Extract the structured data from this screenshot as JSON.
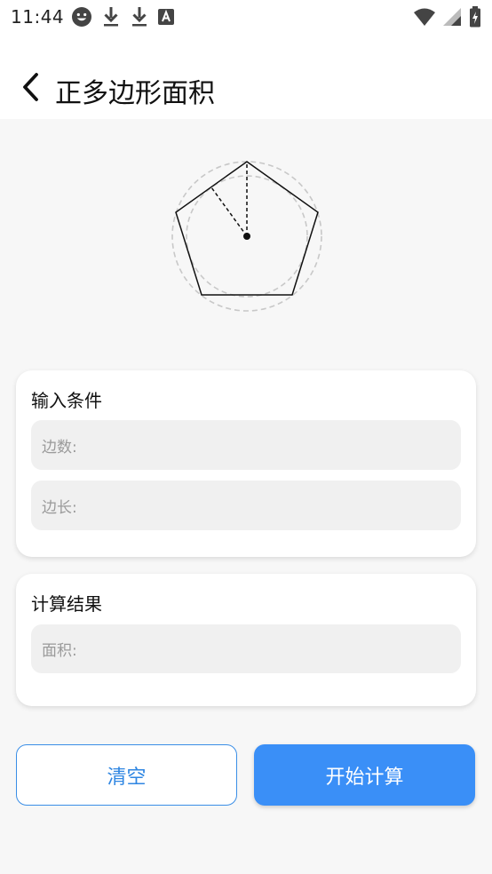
{
  "status_bar": {
    "time": "11:44",
    "left_icons": [
      "smiley-icon",
      "download-icon",
      "download-icon",
      "text-a-icon"
    ],
    "right_icons": [
      "wifi-icon",
      "signal-icon",
      "battery-charging-icon"
    ]
  },
  "header": {
    "back_icon": "chevron-left-icon",
    "title": "正多边形面积"
  },
  "figure": {
    "shape": "regular-pentagon",
    "sides": 5
  },
  "input_card": {
    "title": "输入条件",
    "sides_placeholder": "边数:",
    "length_placeholder": "边长:"
  },
  "result_card": {
    "title": "计算结果",
    "area_placeholder": "面积:"
  },
  "buttons": {
    "clear": "清空",
    "calculate": "开始计算"
  },
  "colors": {
    "accent": "#3a8ff7",
    "outline_button_text": "#2f86e2",
    "field_bg": "#f0f0f0",
    "page_bg": "#f7f7f7"
  }
}
